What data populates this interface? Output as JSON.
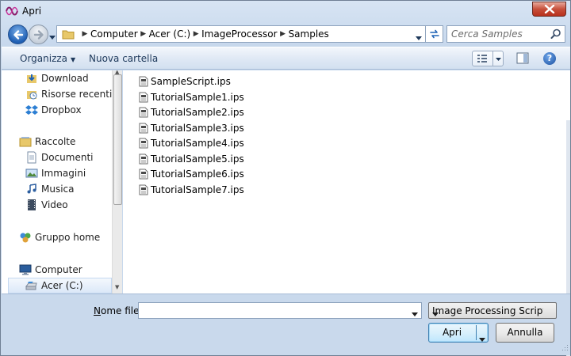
{
  "window": {
    "title": "Apri"
  },
  "address": {
    "breadcrumb": [
      "Computer",
      "Acer (C:)",
      "ImageProcessor",
      "Samples"
    ],
    "search_placeholder": "Cerca Samples"
  },
  "toolbar": {
    "organize_label": "Organizza",
    "new_folder_label": "Nuova cartella"
  },
  "nav_pane": {
    "items": [
      {
        "label": "Download",
        "icon": "download-folder-icon"
      },
      {
        "label": "Risorse recenti",
        "icon": "recent-places-icon"
      },
      {
        "label": "Dropbox",
        "icon": "dropbox-icon"
      },
      {
        "label": "Raccolte",
        "icon": "libraries-icon"
      },
      {
        "label": "Documenti",
        "icon": "documents-icon"
      },
      {
        "label": "Immagini",
        "icon": "pictures-icon"
      },
      {
        "label": "Musica",
        "icon": "music-icon"
      },
      {
        "label": "Video",
        "icon": "video-icon"
      },
      {
        "label": "Gruppo home",
        "icon": "homegroup-icon"
      },
      {
        "label": "Computer",
        "icon": "computer-icon"
      },
      {
        "label": "Acer (C:)",
        "icon": "drive-icon",
        "selected": true
      }
    ]
  },
  "files": [
    "SampleScript.ips",
    "TutorialSample1.ips",
    "TutorialSample2.ips",
    "TutorialSample3.ips",
    "TutorialSample4.ips",
    "TutorialSample5.ips",
    "TutorialSample6.ips",
    "TutorialSample7.ips"
  ],
  "bottom": {
    "filename_label_prefix": "N",
    "filename_label_rest": "ome file:",
    "filename_value": "",
    "filter_value": "Image Processing Script (*.ips)",
    "open_label": "Apri",
    "cancel_label": "Annulla"
  },
  "colors": {
    "accent": "#1f63b6",
    "close_red": "#c7503b",
    "toolbar_text": "#1e395b"
  }
}
